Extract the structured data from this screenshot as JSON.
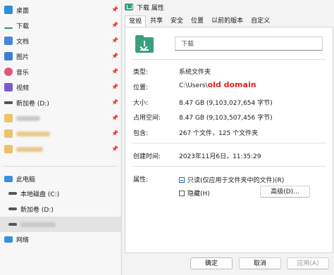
{
  "nav": {
    "items": [
      {
        "label": "桌面",
        "icon": "desktop-icon",
        "pinned": true
      },
      {
        "label": "下载",
        "icon": "download-icon",
        "pinned": true
      },
      {
        "label": "文档",
        "icon": "document-icon",
        "pinned": true
      },
      {
        "label": "图片",
        "icon": "picture-icon",
        "pinned": true
      },
      {
        "label": "音乐",
        "icon": "music-icon",
        "pinned": true
      },
      {
        "label": "视频",
        "icon": "video-icon",
        "pinned": true
      },
      {
        "label": "新加卷 (D:)",
        "icon": "drive-icon",
        "pinned": true
      }
    ],
    "this_pc": "此电脑",
    "local_disk": "本地磁盘 (C:)",
    "new_volume": "新加卷 (D:)",
    "network": "网络"
  },
  "dialog": {
    "title": "下载 属性",
    "tabs": [
      "常规",
      "共享",
      "安全",
      "位置",
      "以前的版本",
      "自定义"
    ],
    "folder_name": "下载",
    "labels": {
      "type": "类型:",
      "location": "位置:",
      "size": "大小:",
      "size_on_disk": "占用空间:",
      "contains": "包含:",
      "created": "创建时间:",
      "attributes": "属性:"
    },
    "values": {
      "type": "系统文件夹",
      "location_prefix": "C:\\Users\\",
      "location_annotation": "old domain",
      "size": "8.47 GB (9,103,027,654 字节)",
      "size_on_disk": "8.47 GB (9,103,507,456 字节)",
      "contains": "267 个文件，125 个文件夹",
      "created": "2023年11月6日，11:35:29"
    },
    "attributes": {
      "readonly": "只读(仅应用于文件夹中的文件)(R)",
      "hidden": "隐藏(H)",
      "advanced_button": "高级(D)..."
    },
    "buttons": {
      "ok": "确定",
      "cancel": "取消",
      "apply": "应用(A)"
    }
  },
  "colors": {
    "folder_green": "#3aa07a",
    "annotation_red": "#e0201b",
    "selection_bg": "#e3e3e3"
  }
}
